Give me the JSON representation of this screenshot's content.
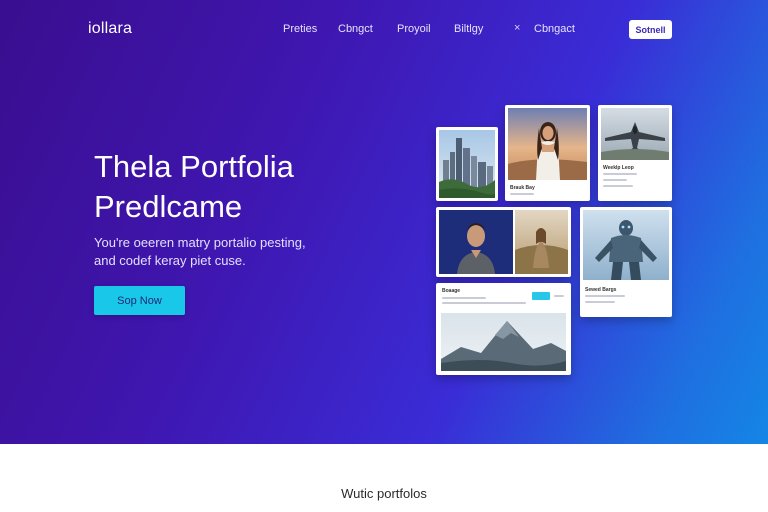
{
  "brand": {
    "logo": "iollara"
  },
  "nav": {
    "items": [
      "Preties",
      "Cbngct",
      "Proyoil",
      "Biltlgy",
      "Cbngact"
    ],
    "close_symbol": "×",
    "button_label": "Sotnell"
  },
  "hero": {
    "title_lines": [
      "Thela Portfolia",
      "Predlcame"
    ],
    "subtitle_lines": [
      "You're oeeren matry portalio pesting,",
      "and codef keray piet cuse."
    ],
    "cta_label": "Sop Now"
  },
  "gallery": {
    "cards": [
      {
        "id": "city",
        "caption": ""
      },
      {
        "id": "woman",
        "caption": "Brauk Bay"
      },
      {
        "id": "jet",
        "caption": "Weeklp Leop"
      },
      {
        "id": "man",
        "caption": ""
      },
      {
        "id": "girl",
        "caption": ""
      },
      {
        "id": "robot",
        "caption": "Sewed Bargs"
      },
      {
        "id": "mountain",
        "caption": "Boaage"
      }
    ]
  },
  "section": {
    "title": "Wutic portfolos"
  },
  "colors": {
    "accent": "#19c7e8",
    "hero_start": "#3a0e8f",
    "hero_end": "#1486e6"
  }
}
